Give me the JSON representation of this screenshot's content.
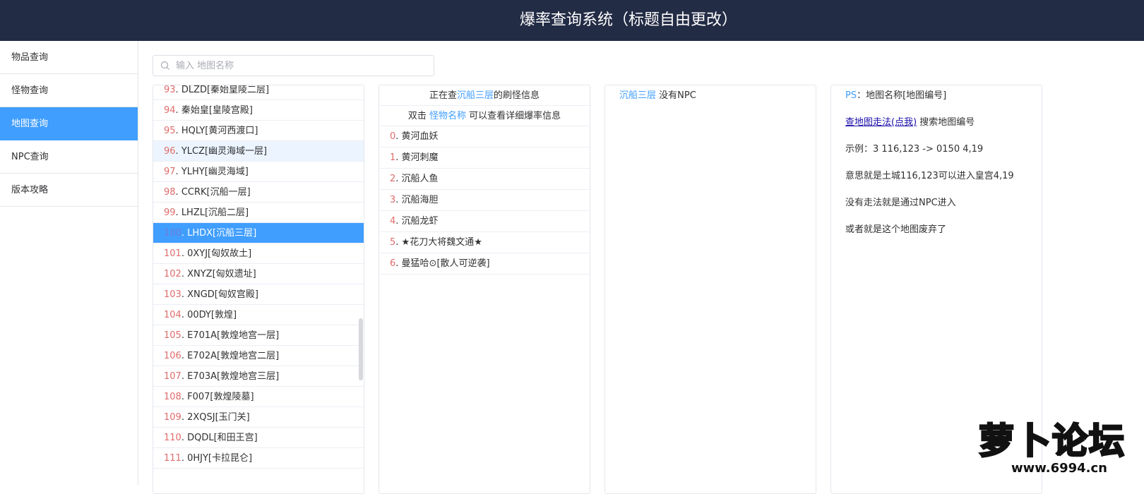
{
  "header": {
    "title": "爆率查询系统（标题自由更改）"
  },
  "sidebar": {
    "items": [
      {
        "label": "物品查询"
      },
      {
        "label": "怪物查询"
      },
      {
        "label": "地图查询"
      },
      {
        "label": "NPC查询"
      },
      {
        "label": "版本攻略"
      }
    ],
    "active": "地图查询"
  },
  "search": {
    "placeholder": "输入 地图名称",
    "value": ""
  },
  "maps": [
    {
      "num": "93",
      "name": "DLZD[秦始皇陵二层]"
    },
    {
      "num": "94",
      "name": "秦始皇[皇陵宫殿]"
    },
    {
      "num": "95",
      "name": "HQLY[黄河西渡口]"
    },
    {
      "num": "96",
      "name": "YLCZ[幽灵海域一层]"
    },
    {
      "num": "97",
      "name": "YLHY[幽灵海域]"
    },
    {
      "num": "98",
      "name": "CCRK[沉船一层]"
    },
    {
      "num": "99",
      "name": "LHZL[沉船二层]"
    },
    {
      "num": "100",
      "name": "LHDX[沉船三层]"
    },
    {
      "num": "101",
      "name": "0XYJ[匈奴故土]"
    },
    {
      "num": "102",
      "name": "XNYZ[匈奴遗址]"
    },
    {
      "num": "103",
      "name": "XNGD[匈奴宫殿]"
    },
    {
      "num": "104",
      "name": "00DY[敦煌]"
    },
    {
      "num": "105",
      "name": "E701A[敦煌地宫一层]"
    },
    {
      "num": "106",
      "name": "E702A[敦煌地宫二层]"
    },
    {
      "num": "107",
      "name": "E703A[敦煌地宫三层]"
    },
    {
      "num": "108",
      "name": "F007[敦煌陵墓]"
    },
    {
      "num": "109",
      "name": "2XQSJ[玉门关]"
    },
    {
      "num": "110",
      "name": "DQDL[和田王宫]"
    },
    {
      "num": "111",
      "name": "0HJY[卡拉昆仑]"
    }
  ],
  "selected_map": "100",
  "hovered_map": "96",
  "monster_panel": {
    "head1_prefix": "正在查",
    "head1_map": "沉船三层",
    "head1_suffix": "的刷怪信息",
    "head2_prefix": "双击 ",
    "head2_link": "怪物名称",
    "head2_suffix": " 可以查看详细爆率信息",
    "monsters": [
      {
        "num": "0",
        "name": "黄河血妖"
      },
      {
        "num": "1",
        "name": "黄河刺魔"
      },
      {
        "num": "2",
        "name": "沉船人鱼"
      },
      {
        "num": "3",
        "name": "沉船海胆"
      },
      {
        "num": "4",
        "name": "沉船龙虾"
      },
      {
        "num": "5",
        "name": "★花刀大将魏文通★"
      },
      {
        "num": "6",
        "name": "曼猛哈⊙[散人可逆袭]"
      }
    ]
  },
  "npc_panel": {
    "map": "沉船三层",
    "text": " 没有NPC"
  },
  "info_panel": {
    "ps_label": "PS",
    "ps_text": "：地图名称[地图编号]",
    "link_text": "查地图走法(点我)",
    "link_suffix": " 搜索地图编号",
    "line3": "示例：3 116,123 -> 0150 4,19",
    "line4": "意思就是土城116,123可以进入皇宫4,19",
    "line5": "没有走法就是通过NPC进入",
    "line6": "或者就是这个地图废弃了"
  },
  "watermark": {
    "main": "萝卜论坛",
    "url": "www.6994.cn"
  },
  "colors": {
    "header_bg": "#232c45",
    "accent": "#409eff",
    "number": "#e06c6c"
  }
}
